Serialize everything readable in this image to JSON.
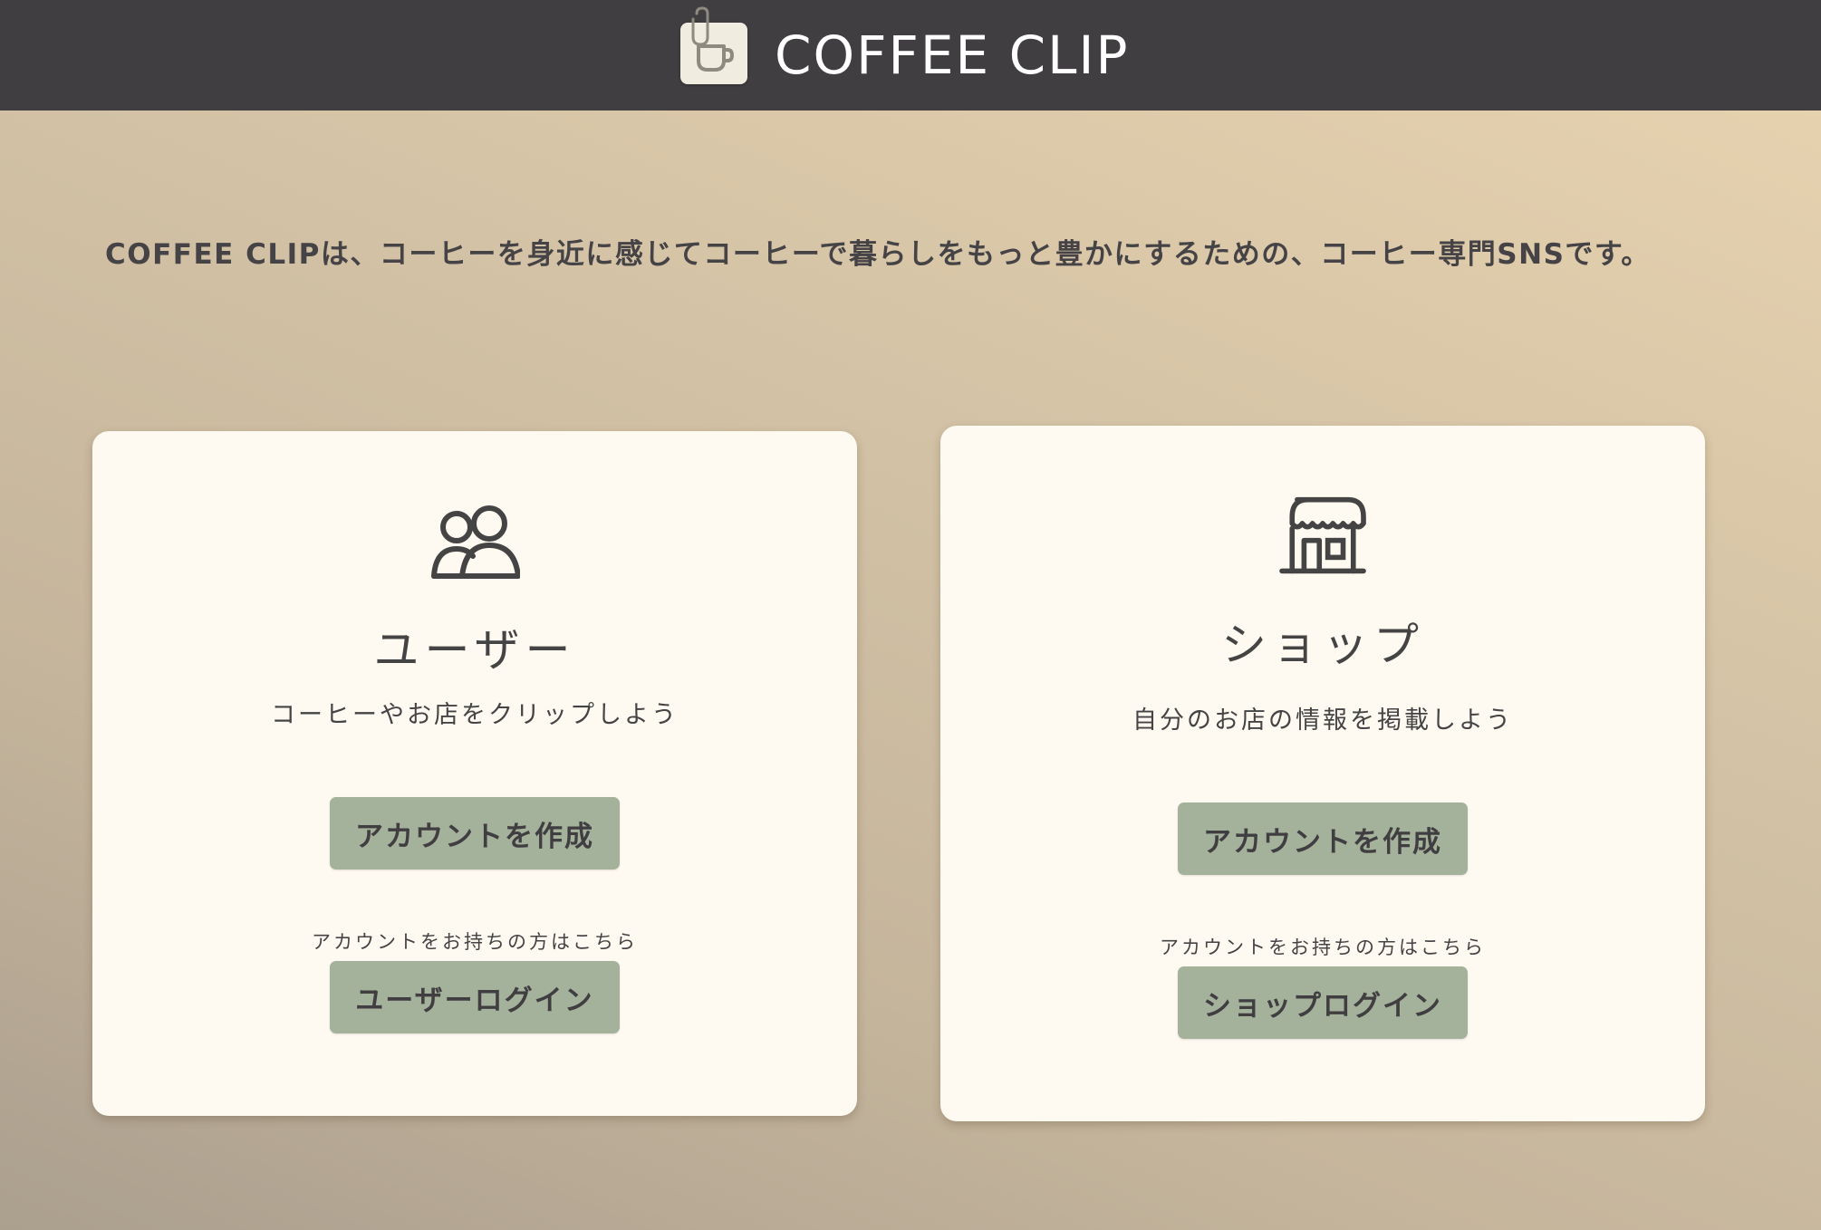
{
  "header": {
    "brand": "COFFEE CLIP",
    "logo_icon": "coffee-cup-clip-icon"
  },
  "tagline": "COFFEE CLIPは、コーヒーを身近に感じてコーヒーで暮らしをもっと豊かにするための、コーヒー専門SNSです。",
  "cards": {
    "user": {
      "icon": "users-icon",
      "title": "ユーザー",
      "subtitle": "コーヒーやお店をクリップしよう",
      "create_label": "アカウントを作成",
      "have_account": "アカウントをお持ちの方はこちら",
      "login_label": "ユーザーログイン"
    },
    "shop": {
      "icon": "storefront-icon",
      "title": "ショップ",
      "subtitle": "自分のお店の情報を掲載しよう",
      "create_label": "アカウントを作成",
      "have_account": "アカウントをお持ちの方はこちら",
      "login_label": "ショップログイン"
    }
  },
  "colors": {
    "header_bg": "#403e41",
    "card_bg": "#fffaf1",
    "button_bg": "#a4b19b",
    "text": "#454445"
  }
}
